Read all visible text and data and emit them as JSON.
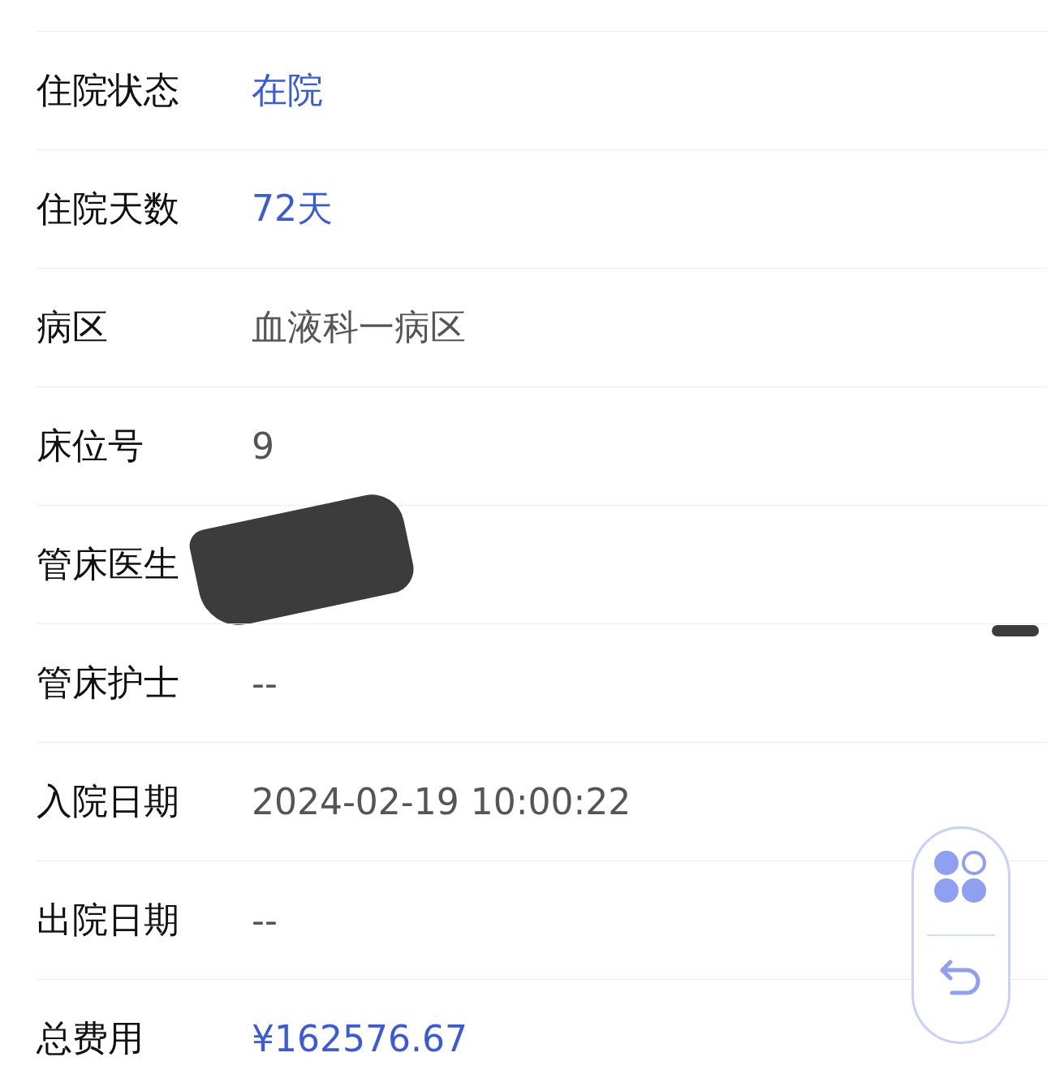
{
  "rows": [
    {
      "label": "住院状态",
      "value": "在院",
      "accent": true
    },
    {
      "label": "住院天数",
      "value": "72天",
      "accent": true
    },
    {
      "label": "病区",
      "value": "血液科一病区",
      "accent": false
    },
    {
      "label": "床位号",
      "value": "9",
      "accent": false
    },
    {
      "label": "管床医生",
      "redacted": true
    },
    {
      "label": "管床护士",
      "value": "--",
      "accent": false
    },
    {
      "label": "入院日期",
      "value": "2024-02-19 10:00:22",
      "accent": false
    },
    {
      "label": "出院日期",
      "value": "--",
      "accent": false
    },
    {
      "label": "总费用",
      "value": "¥162576.67",
      "accent": true
    }
  ]
}
